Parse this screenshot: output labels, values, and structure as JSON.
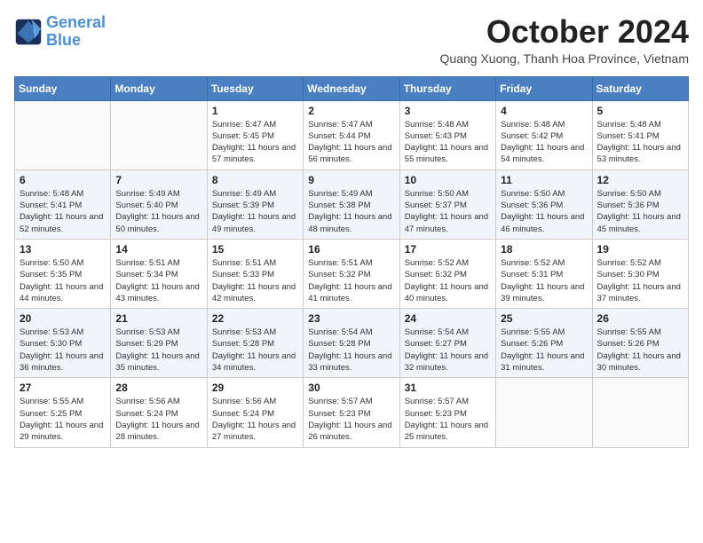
{
  "logo": {
    "line1": "General",
    "line2": "Blue"
  },
  "title": "October 2024",
  "location": "Quang Xuong, Thanh Hoa Province, Vietnam",
  "days_of_week": [
    "Sunday",
    "Monday",
    "Tuesday",
    "Wednesday",
    "Thursday",
    "Friday",
    "Saturday"
  ],
  "weeks": [
    [
      {
        "day": "",
        "sunrise": "",
        "sunset": "",
        "daylight": ""
      },
      {
        "day": "",
        "sunrise": "",
        "sunset": "",
        "daylight": ""
      },
      {
        "day": "1",
        "sunrise": "Sunrise: 5:47 AM",
        "sunset": "Sunset: 5:45 PM",
        "daylight": "Daylight: 11 hours and 57 minutes."
      },
      {
        "day": "2",
        "sunrise": "Sunrise: 5:47 AM",
        "sunset": "Sunset: 5:44 PM",
        "daylight": "Daylight: 11 hours and 56 minutes."
      },
      {
        "day": "3",
        "sunrise": "Sunrise: 5:48 AM",
        "sunset": "Sunset: 5:43 PM",
        "daylight": "Daylight: 11 hours and 55 minutes."
      },
      {
        "day": "4",
        "sunrise": "Sunrise: 5:48 AM",
        "sunset": "Sunset: 5:42 PM",
        "daylight": "Daylight: 11 hours and 54 minutes."
      },
      {
        "day": "5",
        "sunrise": "Sunrise: 5:48 AM",
        "sunset": "Sunset: 5:41 PM",
        "daylight": "Daylight: 11 hours and 53 minutes."
      }
    ],
    [
      {
        "day": "6",
        "sunrise": "Sunrise: 5:48 AM",
        "sunset": "Sunset: 5:41 PM",
        "daylight": "Daylight: 11 hours and 52 minutes."
      },
      {
        "day": "7",
        "sunrise": "Sunrise: 5:49 AM",
        "sunset": "Sunset: 5:40 PM",
        "daylight": "Daylight: 11 hours and 50 minutes."
      },
      {
        "day": "8",
        "sunrise": "Sunrise: 5:49 AM",
        "sunset": "Sunset: 5:39 PM",
        "daylight": "Daylight: 11 hours and 49 minutes."
      },
      {
        "day": "9",
        "sunrise": "Sunrise: 5:49 AM",
        "sunset": "Sunset: 5:38 PM",
        "daylight": "Daylight: 11 hours and 48 minutes."
      },
      {
        "day": "10",
        "sunrise": "Sunrise: 5:50 AM",
        "sunset": "Sunset: 5:37 PM",
        "daylight": "Daylight: 11 hours and 47 minutes."
      },
      {
        "day": "11",
        "sunrise": "Sunrise: 5:50 AM",
        "sunset": "Sunset: 5:36 PM",
        "daylight": "Daylight: 11 hours and 46 minutes."
      },
      {
        "day": "12",
        "sunrise": "Sunrise: 5:50 AM",
        "sunset": "Sunset: 5:36 PM",
        "daylight": "Daylight: 11 hours and 45 minutes."
      }
    ],
    [
      {
        "day": "13",
        "sunrise": "Sunrise: 5:50 AM",
        "sunset": "Sunset: 5:35 PM",
        "daylight": "Daylight: 11 hours and 44 minutes."
      },
      {
        "day": "14",
        "sunrise": "Sunrise: 5:51 AM",
        "sunset": "Sunset: 5:34 PM",
        "daylight": "Daylight: 11 hours and 43 minutes."
      },
      {
        "day": "15",
        "sunrise": "Sunrise: 5:51 AM",
        "sunset": "Sunset: 5:33 PM",
        "daylight": "Daylight: 11 hours and 42 minutes."
      },
      {
        "day": "16",
        "sunrise": "Sunrise: 5:51 AM",
        "sunset": "Sunset: 5:32 PM",
        "daylight": "Daylight: 11 hours and 41 minutes."
      },
      {
        "day": "17",
        "sunrise": "Sunrise: 5:52 AM",
        "sunset": "Sunset: 5:32 PM",
        "daylight": "Daylight: 11 hours and 40 minutes."
      },
      {
        "day": "18",
        "sunrise": "Sunrise: 5:52 AM",
        "sunset": "Sunset: 5:31 PM",
        "daylight": "Daylight: 11 hours and 39 minutes."
      },
      {
        "day": "19",
        "sunrise": "Sunrise: 5:52 AM",
        "sunset": "Sunset: 5:30 PM",
        "daylight": "Daylight: 11 hours and 37 minutes."
      }
    ],
    [
      {
        "day": "20",
        "sunrise": "Sunrise: 5:53 AM",
        "sunset": "Sunset: 5:30 PM",
        "daylight": "Daylight: 11 hours and 36 minutes."
      },
      {
        "day": "21",
        "sunrise": "Sunrise: 5:53 AM",
        "sunset": "Sunset: 5:29 PM",
        "daylight": "Daylight: 11 hours and 35 minutes."
      },
      {
        "day": "22",
        "sunrise": "Sunrise: 5:53 AM",
        "sunset": "Sunset: 5:28 PM",
        "daylight": "Daylight: 11 hours and 34 minutes."
      },
      {
        "day": "23",
        "sunrise": "Sunrise: 5:54 AM",
        "sunset": "Sunset: 5:28 PM",
        "daylight": "Daylight: 11 hours and 33 minutes."
      },
      {
        "day": "24",
        "sunrise": "Sunrise: 5:54 AM",
        "sunset": "Sunset: 5:27 PM",
        "daylight": "Daylight: 11 hours and 32 minutes."
      },
      {
        "day": "25",
        "sunrise": "Sunrise: 5:55 AM",
        "sunset": "Sunset: 5:26 PM",
        "daylight": "Daylight: 11 hours and 31 minutes."
      },
      {
        "day": "26",
        "sunrise": "Sunrise: 5:55 AM",
        "sunset": "Sunset: 5:26 PM",
        "daylight": "Daylight: 11 hours and 30 minutes."
      }
    ],
    [
      {
        "day": "27",
        "sunrise": "Sunrise: 5:55 AM",
        "sunset": "Sunset: 5:25 PM",
        "daylight": "Daylight: 11 hours and 29 minutes."
      },
      {
        "day": "28",
        "sunrise": "Sunrise: 5:56 AM",
        "sunset": "Sunset: 5:24 PM",
        "daylight": "Daylight: 11 hours and 28 minutes."
      },
      {
        "day": "29",
        "sunrise": "Sunrise: 5:56 AM",
        "sunset": "Sunset: 5:24 PM",
        "daylight": "Daylight: 11 hours and 27 minutes."
      },
      {
        "day": "30",
        "sunrise": "Sunrise: 5:57 AM",
        "sunset": "Sunset: 5:23 PM",
        "daylight": "Daylight: 11 hours and 26 minutes."
      },
      {
        "day": "31",
        "sunrise": "Sunrise: 5:57 AM",
        "sunset": "Sunset: 5:23 PM",
        "daylight": "Daylight: 11 hours and 25 minutes."
      },
      {
        "day": "",
        "sunrise": "",
        "sunset": "",
        "daylight": ""
      },
      {
        "day": "",
        "sunrise": "",
        "sunset": "",
        "daylight": ""
      }
    ]
  ]
}
